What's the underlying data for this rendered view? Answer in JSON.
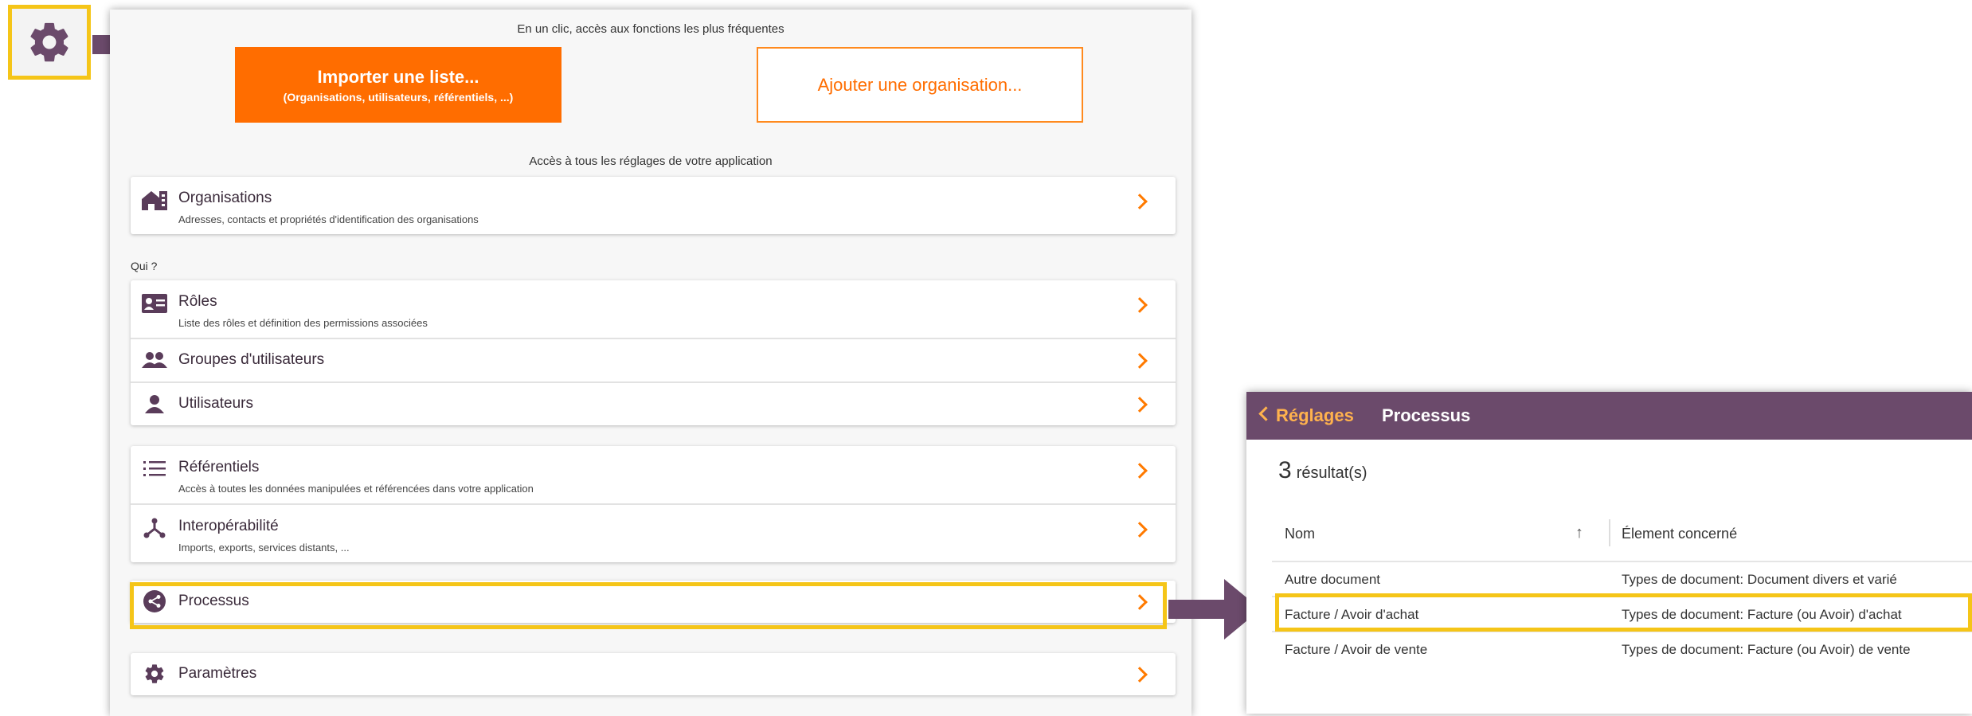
{
  "panel": {
    "quick_caption": "En un clic, accès aux fonctions les plus fréquentes",
    "import_button": {
      "title": "Importer une liste...",
      "subtitle": "(Organisations, utilisateurs, référentiels, ...)"
    },
    "add_org_button": "Ajouter une organisation...",
    "settings_caption": "Accès à tous les réglages de votre application",
    "organisations": {
      "title": "Organisations",
      "subtitle": "Adresses, contacts et propriétés d'identification des organisations"
    },
    "who_label": "Qui ?",
    "roles": {
      "title": "Rôles",
      "subtitle": "Liste des rôles et définition des permissions associées"
    },
    "user_groups": {
      "title": "Groupes d'utilisateurs"
    },
    "users": {
      "title": "Utilisateurs"
    },
    "referentials": {
      "title": "Référentiels",
      "subtitle": "Accès à toutes les données manipulées et référencées dans votre application"
    },
    "interop": {
      "title": "Interopérabilité",
      "subtitle": "Imports, exports, services distants, ..."
    },
    "processes": {
      "title": "Processus"
    },
    "parameters": {
      "title": "Paramètres"
    }
  },
  "process_panel": {
    "back_label": "Réglages",
    "title": "Processus",
    "result_count": "3",
    "result_label": "résultat(s)",
    "columns": {
      "name": "Nom",
      "element": "Élement concerné"
    },
    "rows": [
      {
        "name": "Autre document",
        "element": "Types de document: Document divers et varié"
      },
      {
        "name": "Facture / Avoir d'achat",
        "element": "Types de document: Facture (ou Avoir) d'achat"
      },
      {
        "name": "Facture / Avoir de vente",
        "element": "Types de document: Facture (ou Avoir) de vente"
      }
    ]
  },
  "colors": {
    "accent": "#ff6d00",
    "header": "#6b4a6b",
    "highlight": "#f5c518",
    "arrow": "#6b4a6b"
  },
  "icons": [
    "gear-icon",
    "building-icon",
    "id-card-icon",
    "users-group-icon",
    "user-icon",
    "list-icon",
    "hub-icon",
    "share-icon",
    "sort-arrow-icon"
  ]
}
